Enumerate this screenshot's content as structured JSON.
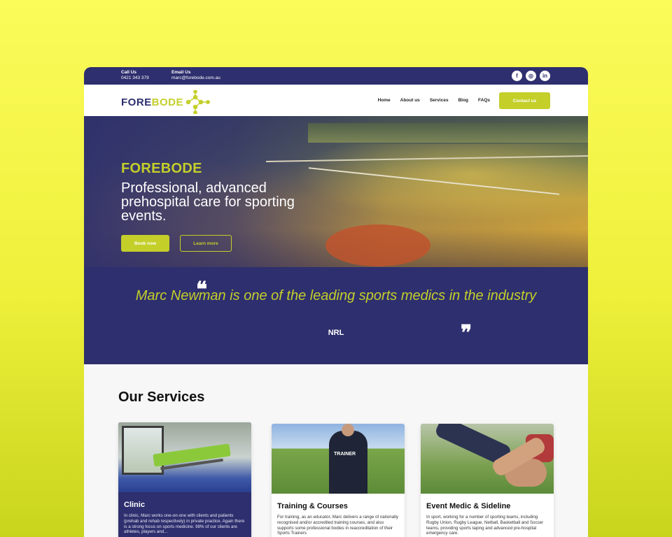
{
  "topbar": {
    "call_label": "Call Us",
    "call_value": "0421 343 379",
    "email_label": "Email Us",
    "email_value": "marc@forebode.com.au",
    "social": [
      {
        "icon": "facebook-icon",
        "glyph": "f"
      },
      {
        "icon": "instagram-icon",
        "glyph": "◎"
      },
      {
        "icon": "linkedin-icon",
        "glyph": "in"
      }
    ]
  },
  "nav": {
    "logo_fore": "FORE",
    "logo_bode": "BODE",
    "items": [
      "Home",
      "About us",
      "Services",
      "Blog",
      "FAQs"
    ],
    "cta": "Contact us"
  },
  "hero": {
    "kicker": "FOREBODE",
    "headline": "Professional, advanced prehospital care for sporting events.",
    "primary_button": "Book now",
    "secondary_button": "Learn more"
  },
  "quote": {
    "open_mark": "❝",
    "close_mark": "❞",
    "text": "Marc Newman is one of the leading sports medics in the industry",
    "source": "NRL"
  },
  "services": {
    "heading": "Our Services",
    "cards": [
      {
        "title": "Clinic",
        "text": "In clinic, Marc works one-on-one with clients and patients (prehab and rehab respectively) in private practice. Again there is a strong focus on sports medicine. 98% of our clients are athletes, players and..."
      },
      {
        "title": "Training & Courses",
        "text": "For training, as an educator, Marc delivers a range of nationally recognised and/or accredited training courses, and also supports some professional bodies in reaccreditation of their Sports Trainers",
        "image_label": "TRAINER"
      },
      {
        "title": "Event Medic & Sideline",
        "text": "In sport, working for a number of sporting teams, including Rugby Union, Rugby League, Netball, Basketball and Soccer teams, providing sports taping and advanced pre-hospital emergency care."
      }
    ]
  },
  "colors": {
    "navy": "#2e2f6e",
    "lime": "#c4cf2a",
    "background_yellow": "#f2f53c"
  }
}
